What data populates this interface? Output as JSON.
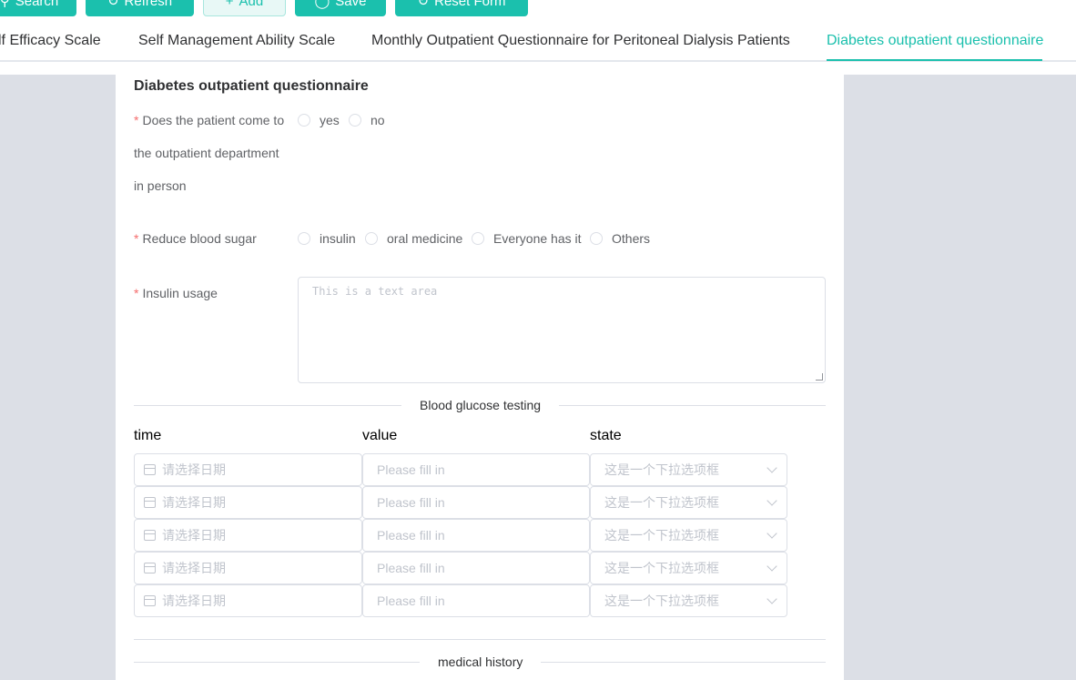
{
  "toolbar": {
    "search_label": "Search",
    "refresh_label": "Refresh",
    "add_label": "Add",
    "save_label": "Save",
    "reset_label": "Reset Form",
    "accent_color": "#1bc0ad"
  },
  "tabs": [
    {
      "label": "lf Efficacy Scale"
    },
    {
      "label": "Self Management Ability Scale"
    },
    {
      "label": "Monthly Outpatient Questionnaire for Peritoneal Dialysis Patients"
    },
    {
      "label": "Diabetes outpatient questionnaire",
      "active": true
    }
  ],
  "form": {
    "title": "Diabetes outpatient questionnaire",
    "required_mark": "*",
    "q1": {
      "label_line1": "Does the patient come to",
      "label_line2": "the outpatient department",
      "label_line3": "in person",
      "options": [
        "yes",
        "no"
      ]
    },
    "q2": {
      "label": "Reduce blood sugar",
      "options": [
        "insulin",
        "oral medicine",
        "Everyone has it",
        "Others"
      ]
    },
    "q3": {
      "label": "Insulin usage",
      "placeholder": "This is a text area"
    },
    "glucose_section": {
      "title": "Blood glucose testing",
      "columns": [
        "time",
        "value",
        "state"
      ],
      "rows": [
        {
          "date_placeholder": "请选择日期",
          "value_placeholder": "Please fill in",
          "state_placeholder": "这是一个下拉选项框"
        },
        {
          "date_placeholder": "请选择日期",
          "value_placeholder": "Please fill in",
          "state_placeholder": "这是一个下拉选项框"
        },
        {
          "date_placeholder": "请选择日期",
          "value_placeholder": "Please fill in",
          "state_placeholder": "这是一个下拉选项框"
        },
        {
          "date_placeholder": "请选择日期",
          "value_placeholder": "Please fill in",
          "state_placeholder": "这是一个下拉选项框"
        },
        {
          "date_placeholder": "请选择日期",
          "value_placeholder": "Please fill in",
          "state_placeholder": "这是一个下拉选项框"
        }
      ]
    },
    "history_section": {
      "title": "medical history"
    }
  }
}
